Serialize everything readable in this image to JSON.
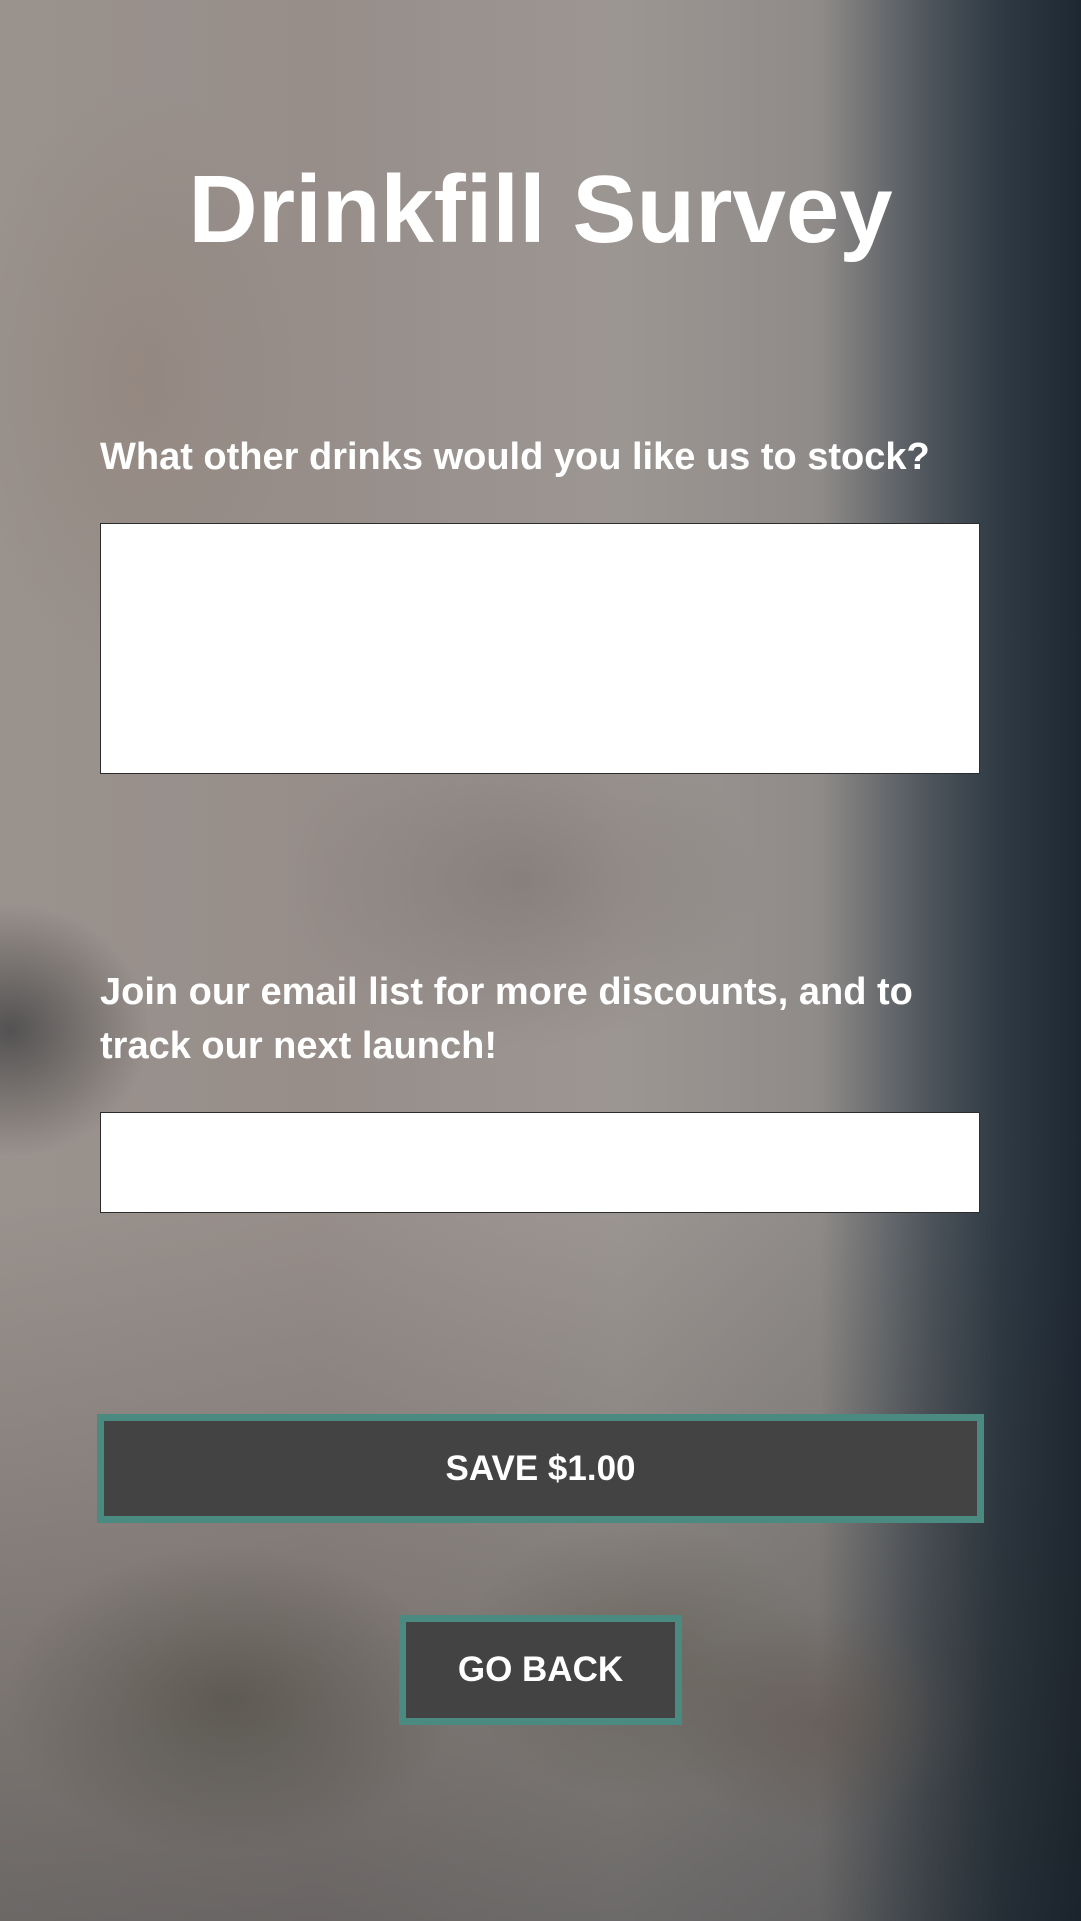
{
  "page": {
    "title": "Drinkfill Survey"
  },
  "form": {
    "drinks_question": "What other drinks would you like us to stock?",
    "drinks_value": "",
    "email_question": "Join our email list for more discounts, and to track our next launch!",
    "email_value": ""
  },
  "actions": {
    "save_label": "SAVE $1.00",
    "back_label": "GO BACK"
  },
  "colors": {
    "button_fill": "#434343",
    "button_border": "#4a8a80",
    "text": "#ffffff",
    "input_fill": "#ffffff"
  }
}
